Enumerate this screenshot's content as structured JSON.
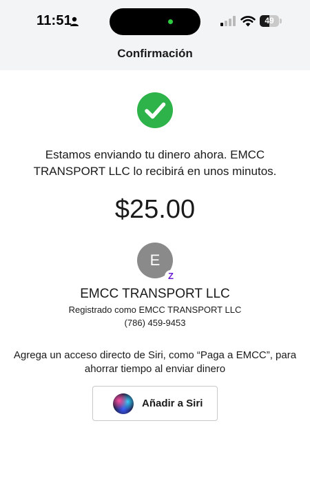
{
  "status_bar": {
    "time": "11:51",
    "battery_level": "49",
    "battery_fraction": 0.49,
    "icons": [
      "person-icon",
      "signal-icon",
      "wifi-icon",
      "battery-icon"
    ]
  },
  "header": {
    "title": "Confirmación"
  },
  "confirmation": {
    "icon": "check-circle-icon",
    "message": "Estamos enviando tu dinero ahora. EMCC TRANSPORT LLC lo recibirá en unos minutos.",
    "amount": "$25.00"
  },
  "recipient": {
    "avatar_initial": "E",
    "badge_letter": "Z",
    "name": "EMCC TRANSPORT LLC",
    "registered_as": "Registrado como EMCC TRANSPORT LLC",
    "phone": "(786) 459-9453"
  },
  "siri": {
    "prompt": "Agrega un acceso directo de Siri, como “Paga a EMCC”, para ahorrar tiempo al enviar dinero",
    "button_label": "Añadir a Siri",
    "button_icon": "siri-orb-icon"
  },
  "colors": {
    "success_green": "#2db34a",
    "zelle_purple": "#6d1ed4",
    "header_bg": "#f3f4f6"
  }
}
